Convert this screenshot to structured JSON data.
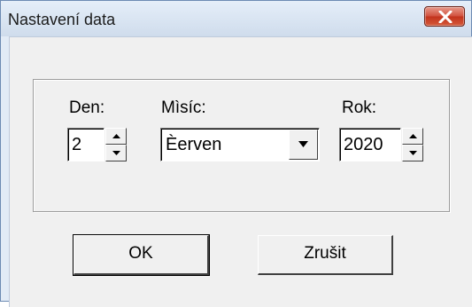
{
  "window": {
    "title": "Nastavení data"
  },
  "fields": {
    "day": {
      "label": "Den:",
      "value": "2"
    },
    "month": {
      "label": "Mìsíc:",
      "value": "Èerven"
    },
    "year": {
      "label": "Rok:",
      "value": "2020"
    }
  },
  "buttons": {
    "ok": "OK",
    "cancel": "Zrušit"
  }
}
